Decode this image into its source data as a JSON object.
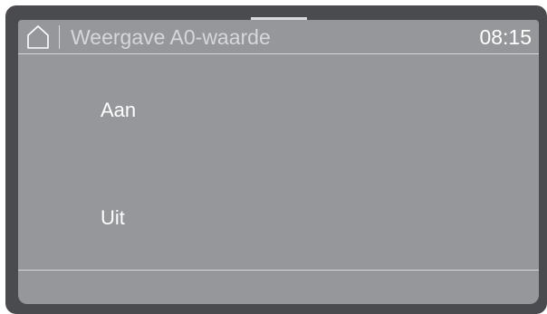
{
  "header": {
    "home_icon": "home-icon",
    "title": "Weergave A0-waarde",
    "clock": "08:15"
  },
  "options": [
    {
      "label": "Aan"
    },
    {
      "label": "Uit"
    }
  ],
  "colors": {
    "bezel": "#4a4b4f",
    "screen": "#96979b",
    "text": "#ffffff",
    "divider": "#d6d7d9"
  }
}
